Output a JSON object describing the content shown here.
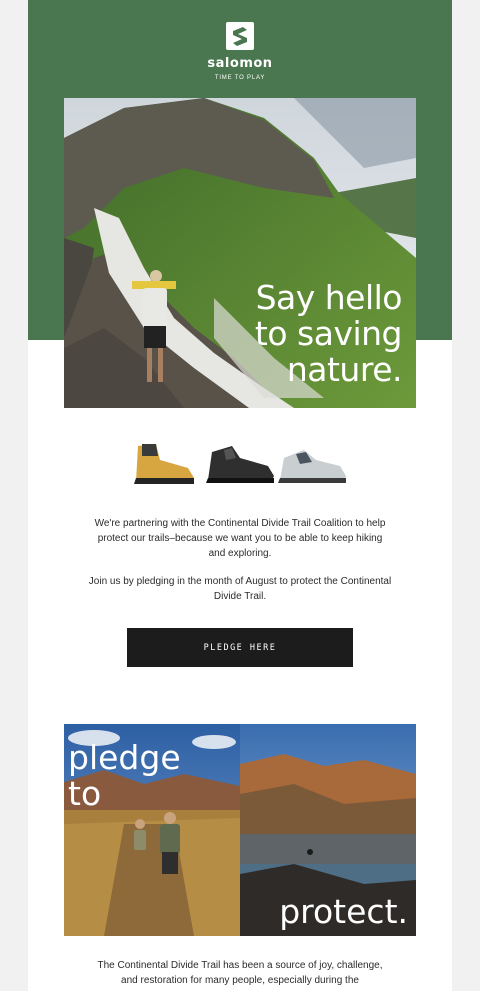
{
  "brand": {
    "name": "salomon",
    "tagline": "TIME TO PLAY"
  },
  "hero": {
    "headline": "Say hello\nto saving\nnature."
  },
  "shoes": [
    {
      "icon": "yellow-boot-icon",
      "color": "#d8a640"
    },
    {
      "icon": "black-shoe-icon",
      "color": "#2f2f2f"
    },
    {
      "icon": "grey-shoe-icon",
      "color": "#c9ced0"
    }
  ],
  "body": {
    "paragraph_1": "We're partnering with the Continental Divide Trail Coalition to help protect our trails–because we want you to be able to keep hiking and exploring.",
    "paragraph_2": "Join us by pledging in the month of August to protect the Continental Divide Trail.",
    "cta_label": "PLEDGE HERE",
    "paragraph_3": "The Continental Divide Trail has been a source of joy, challenge, and restoration for many people, especially during the"
  },
  "feature": {
    "headline_left": "pledge\nto",
    "headline_right": "protect."
  },
  "colors": {
    "brand_green": "#4b7750",
    "cta_bg": "#1c1c1c"
  }
}
